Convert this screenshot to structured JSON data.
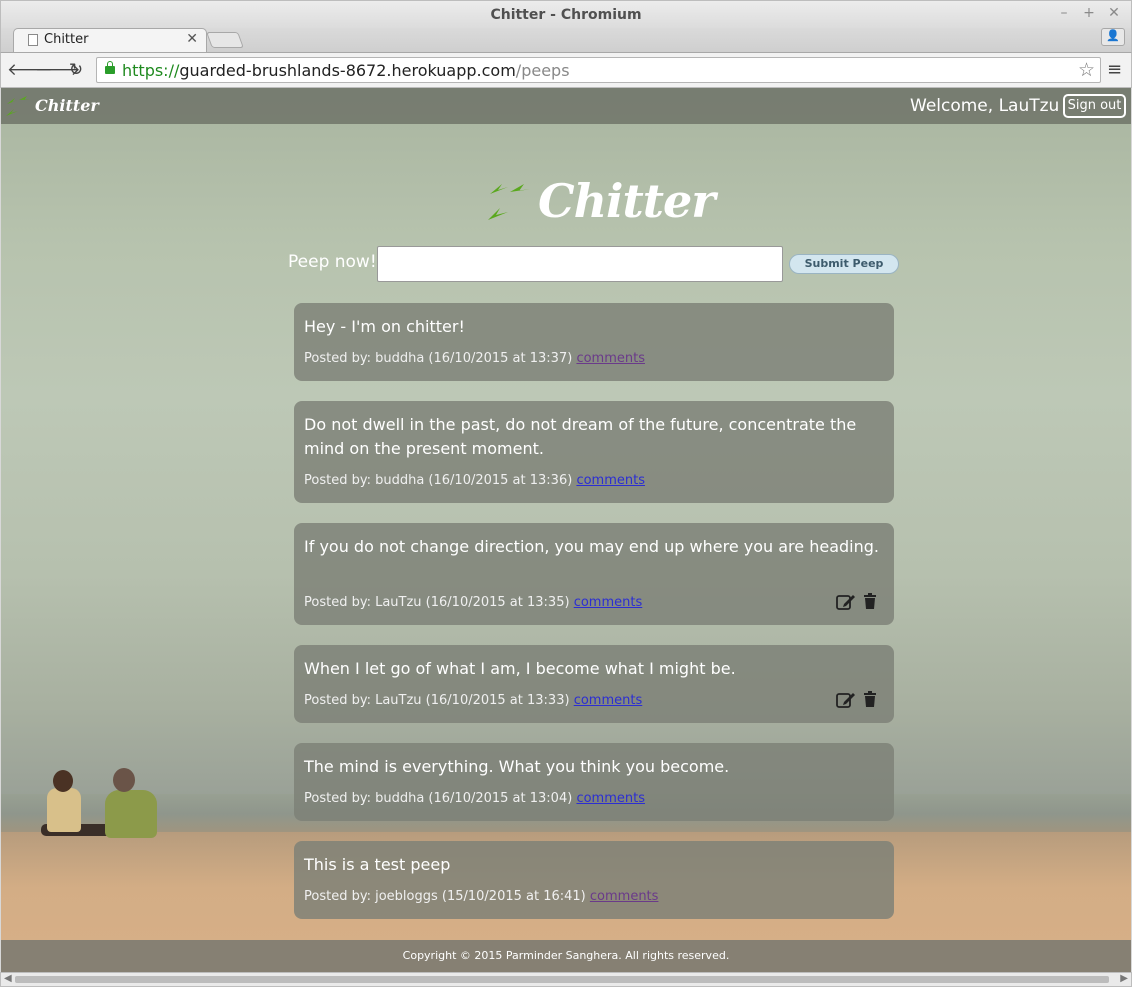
{
  "window": {
    "title": "Chitter - Chromium",
    "minimize": "–",
    "maximize": "+",
    "close": "✕"
  },
  "tabs": [
    {
      "label": "Chitter",
      "close": "✕"
    }
  ],
  "toolbar": {
    "back": "🡐",
    "forward": "🡒",
    "reload": "↻",
    "url_scheme": "https://",
    "url_host": "guarded-brushlands-8672.herokuapp.com",
    "url_path": "/peeps",
    "star": "☆",
    "menu": "≡",
    "profile": "👤"
  },
  "navbar": {
    "brand": "Chitter",
    "welcome": "Welcome, LauTzu",
    "signout": "Sign out"
  },
  "hero": {
    "title": "Chitter"
  },
  "form": {
    "label": "Peep now!",
    "input_value": "",
    "submit": "Submit Peep"
  },
  "peeps": [
    {
      "text": "Hey - I'm on chitter!",
      "meta": "Posted by: buddha (16/10/2015 at 13:37)",
      "link": "comments",
      "visited": true,
      "own": false
    },
    {
      "text": "Do not dwell in the past, do not dream of the future, concentrate the mind on the present moment.",
      "meta": "Posted by: buddha (16/10/2015 at 13:36)",
      "link": "comments",
      "visited": false,
      "own": false
    },
    {
      "text": "If you do not change direction, you may end up where you are heading.",
      "meta": "Posted by: LauTzu (16/10/2015 at 13:35)",
      "link": "comments",
      "visited": false,
      "own": true
    },
    {
      "text": "When I let go of what I am, I become what I might be.",
      "meta": "Posted by: LauTzu (16/10/2015 at 13:33)",
      "link": "comments",
      "visited": false,
      "own": true
    },
    {
      "text": "The mind is everything. What you think you become.",
      "meta": "Posted by: buddha (16/10/2015 at 13:04)",
      "link": "comments",
      "visited": false,
      "own": false
    },
    {
      "text": "This is a test peep",
      "meta": "Posted by: joebloggs (15/10/2015 at 16:41)",
      "link": "comments",
      "visited": true,
      "own": false
    }
  ],
  "footer": {
    "text": "Copyright © 2015 Parminder Sanghera. All rights reserved."
  },
  "colors": {
    "logo_green": "#5aa81e",
    "link": "#2c2ed2",
    "link_visited": "#6a3a8a"
  },
  "icons": {
    "logo": "birds-logo-icon",
    "edit": "edit-icon",
    "delete": "trash-icon",
    "lock": "lock-icon",
    "star": "star-icon"
  }
}
